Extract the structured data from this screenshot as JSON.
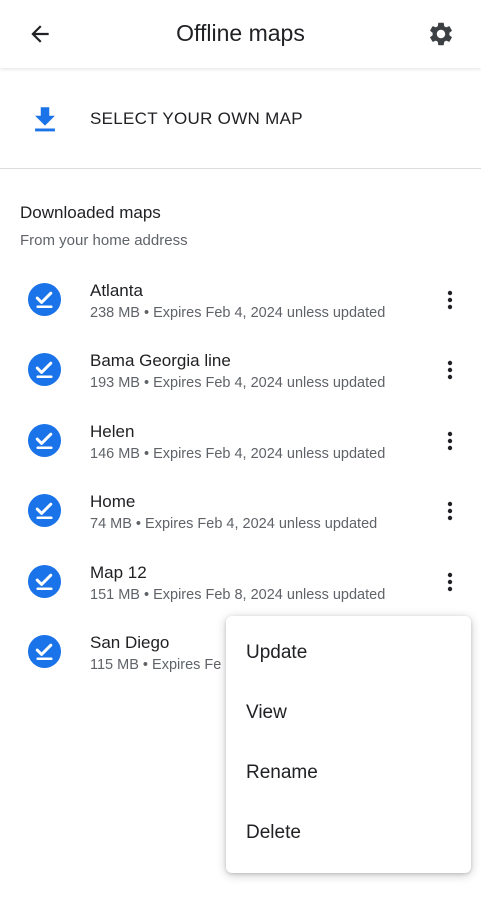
{
  "header": {
    "title": "Offline maps",
    "back_icon": "arrow-back-icon",
    "settings_icon": "gear-icon"
  },
  "select_map": {
    "label": "SELECT YOUR OWN MAP",
    "icon": "download-icon"
  },
  "section": {
    "title": "Downloaded maps",
    "subtitle": "From your home address"
  },
  "maps": [
    {
      "name": "Atlanta",
      "meta": "238 MB • Expires Feb 4, 2024 unless updated"
    },
    {
      "name": "Bama Georgia line",
      "meta": "193 MB • Expires Feb 4, 2024 unless updated"
    },
    {
      "name": "Helen",
      "meta": "146 MB • Expires Feb 4, 2024 unless updated"
    },
    {
      "name": "Home",
      "meta": "74 MB • Expires Feb 4, 2024 unless updated"
    },
    {
      "name": "Map 12",
      "meta": "151 MB • Expires Feb 8, 2024 unless updated"
    },
    {
      "name": "San Diego",
      "meta": "115 MB • Expires Fe"
    }
  ],
  "context_menu": {
    "items": [
      "Update",
      "View",
      "Rename",
      "Delete"
    ]
  },
  "colors": {
    "accent": "#1a73e8",
    "text_primary": "#202124",
    "text_secondary": "#5f6368",
    "divider": "#dadce0"
  }
}
